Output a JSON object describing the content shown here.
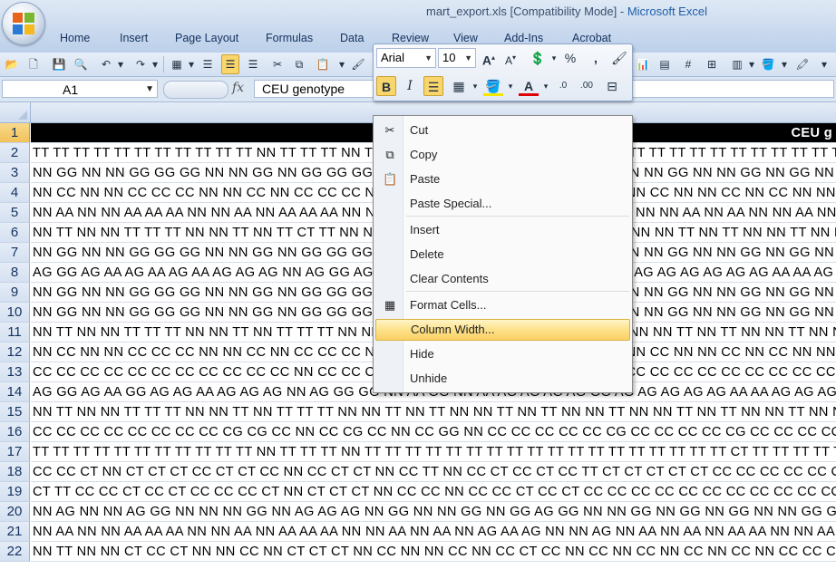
{
  "window": {
    "title": "mart_export.xls  [Compatibility Mode]",
    "separator": "-",
    "app_name": "Microsoft Excel"
  },
  "ribbon_tabs": [
    "Home",
    "Insert",
    "Page Layout",
    "Formulas",
    "Data",
    "Review",
    "View",
    "Add-Ins",
    "Acrobat"
  ],
  "formula_bar": {
    "name_box": "A1",
    "fx_label": "fx",
    "content": "CEU genotype"
  },
  "mini_toolbar": {
    "font_name": "Arial",
    "font_size": "10",
    "grow_font": "A",
    "shrink_font": "A",
    "percent": "%",
    "comma": ",",
    "bold": "B",
    "italic": "I",
    "font_color_letter": "A",
    "increase_decimal": ".0",
    "decrease_decimal": ".00"
  },
  "grid": {
    "header_cell_text": "CEU g",
    "rows": [
      {
        "num": "1",
        "text": ""
      },
      {
        "num": "2",
        "text": "TT TT TT TT TT TT TT TT TT TT TT NN TT TT TT NN TT TT TT TT TT TT TT TT TT TT TT TT TT TT TT TT TT TT TT TT TT TT TT TT TT TT TT TT TT TT TT TT TT CT"
      },
      {
        "num": "3",
        "text": "NN GG NN NN GG GG GG NN NN GG NN GG GG GG NN NN GG NN GG NN NN GG NN GG NN NN GG NN NN GG NN GG NN NN GG NN NN GG GG GG"
      },
      {
        "num": "4",
        "text": "NN CC NN NN CC CC CC NN NN CC NN CC CC CC NN NN CC NN CC NN NN CC NN CC NN NN CC NN NN CC NN CC NN NN CC NN NN CC CC CC"
      },
      {
        "num": "5",
        "text": "NN AA NN NN AA AA AA NN NN AA NN AA AA AA NN NN AA NN AA NN NN AA NN AA NN NN AA NN NN AA NN AA NN NN AA NN NN AA AA AA"
      },
      {
        "num": "6",
        "text": "NN TT NN NN TT TT TT NN NN TT NN TT CT TT NN NN TT NN TT NN NN TT NN TT NN NN TT NN NN TT NN TT NN NN TT NN NN TT TT TT"
      },
      {
        "num": "7",
        "text": "NN GG NN NN GG GG GG NN NN GG NN GG GG GG NN NN GG NN GG NN NN GG NN GG NN NN GG NN NN GG NN GG NN NN GG NN NN GG GG GG"
      },
      {
        "num": "8",
        "text": "AG GG AG AA AG AA AG AA AG AG AG NN AG GG AG AG AG AG AG AG AG AG AG AG GG GG AG AG AG AG AG AG AA AA AG AG AG AG AG AA"
      },
      {
        "num": "9",
        "text": "NN GG NN NN GG GG GG NN NN GG NN GG GG GG NN NN GG NN GG NN NN GG NN GG NN NN GG NN NN GG NN GG NN NN GG NN NN GG GG GG"
      },
      {
        "num": "10",
        "text": "NN GG NN NN GG GG GG NN NN GG NN GG GG GG NN NN GG NN GG NN NN GG NN GG NN NN GG NN NN GG NN GG NN NN GG NN NN GG GG GG"
      },
      {
        "num": "11",
        "text": "NN TT NN NN TT TT TT NN NN TT NN TT TT TT NN NN TT NN TT NN NN TT NN TT NN NN TT NN NN TT NN TT NN NN TT NN NN TT TT TT"
      },
      {
        "num": "12",
        "text": "NN CC NN NN CC CC CC NN NN CC NN CC CC CC NN NN CC NN CC NN NN CC NN CC NN NN CC NN NN CC NN CC NN NN CC NN NN CC CC CC"
      },
      {
        "num": "13",
        "text": "CC CC CC CC CC CC CC CC CC CC CC NN CC CC CC CC CC CC CC CC CC CC CC CC CC CC CC CC CC CC CC CC CC CC CC CC CC CC CC CC"
      },
      {
        "num": "14",
        "text": "AG GG AG AA GG AG AG AA AG AG AG NN AG GG GG NN AA GG NN AA AG AG AG AG GG AG AG AG AG AG AA AA AG AG AG AG AG AA"
      },
      {
        "num": "15",
        "text": "NN TT NN NN TT TT TT NN NN TT NN TT TT TT NN NN TT NN TT NN NN TT NN TT NN NN TT NN NN TT NN TT NN NN TT NN NN TT TT TT"
      },
      {
        "num": "16",
        "text": "CC CC CC CC CC CC CC CC CG CG CC NN CC CG CC NN CC GG NN CC CC CC CC CC CG CC CC CC CC CG CC CC CC CC CC CC CC CC"
      },
      {
        "num": "17",
        "text": "TT TT TT TT TT TT TT TT TT TT TT NN TT TT TT NN TT TT TT TT TT TT TT TT TT TT TT TT TT TT TT TT TT TT CT TT TT TT TT TT"
      },
      {
        "num": "18",
        "text": "CC CC CT NN CT CT CT CC CT CT CC NN CC CT CT NN CC TT NN CC CT CC CT CC TT CT CT CT CT CT CC CC CC CC CC CC CC CC"
      },
      {
        "num": "19",
        "text": "CT TT CC CC CT CC CT CC CC CC CT NN CT CT CT NN CC CC NN CC CC CT CC CT CC CC CC CC CC CC CC CC CC CC CC CC CC CC"
      },
      {
        "num": "20",
        "text": "NN AG NN NN AG GG NN NN NN GG NN AG AG AG NN GG NN NN GG NN GG AG GG NN NN GG NN GG NN GG NN NN GG GG GG GG"
      },
      {
        "num": "21",
        "text": "NN AA NN NN AA AA AA NN NN AA NN AA AA AA NN NN AA NN AA NN AG AA AG NN NN AG NN AA NN AA NN AA AA NN NN AA AA AA"
      },
      {
        "num": "22",
        "text": "NN TT NN NN CT CC CT NN NN CC NN CT CT CT NN CC NN NN CC NN CC CT CC NN CC NN CC NN CC NN CC NN CC CC CC NN"
      }
    ]
  },
  "context_menu": {
    "items": [
      {
        "label": "Cut",
        "icon": "scissors-icon",
        "glyph": "✂"
      },
      {
        "label": "Copy",
        "icon": "copy-icon",
        "glyph": "⧉"
      },
      {
        "label": "Paste",
        "icon": "paste-icon",
        "glyph": "📋"
      },
      {
        "label": "Paste Special...",
        "icon": "",
        "glyph": ""
      },
      {
        "label": "Insert",
        "icon": "",
        "glyph": ""
      },
      {
        "label": "Delete",
        "icon": "",
        "glyph": ""
      },
      {
        "label": "Clear Contents",
        "icon": "",
        "glyph": ""
      },
      {
        "label": "Format Cells...",
        "icon": "format-cells-icon",
        "glyph": "▦"
      },
      {
        "label": "Column Width...",
        "icon": "",
        "glyph": ""
      },
      {
        "label": "Hide",
        "icon": "",
        "glyph": ""
      },
      {
        "label": "Unhide",
        "icon": "",
        "glyph": ""
      }
    ]
  }
}
